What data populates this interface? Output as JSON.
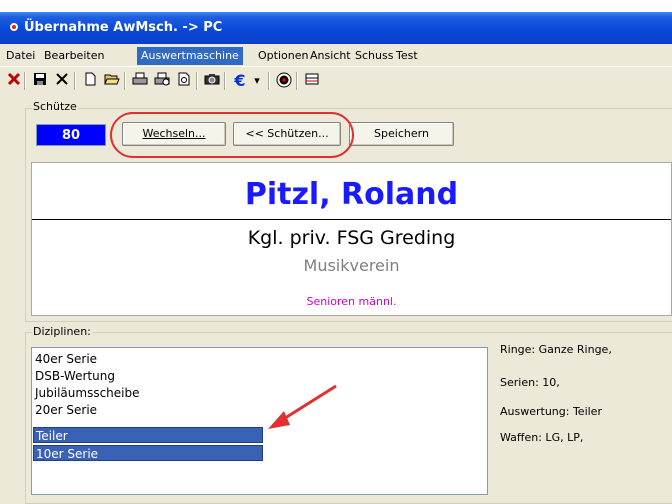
{
  "window": {
    "title": "Übernahme AwMsch. -> PC"
  },
  "menu": [
    "Datei",
    "Bearbeiten",
    "Auswertmaschine",
    "Optionen",
    "Ansicht",
    "Schuss",
    "Test"
  ],
  "toolbar_icons": [
    "close-icon",
    "save-icon",
    "delete-icon",
    "new-document-icon",
    "open-folder-icon",
    "print-icon",
    "print-setup-icon",
    "print-preview-icon",
    "camera-icon",
    "euro-icon",
    "dropdown-arrow-icon",
    "target-icon",
    "layout-icon"
  ],
  "toolbar_glyphs": {
    "euro": "€",
    "dropdown": "▾"
  },
  "schuetze": {
    "group_label": "Schütze",
    "number": "80",
    "wechseln_label": "Wechseln...",
    "schuetzen_label": "<< Schützen...",
    "speichern_label": "Speichern"
  },
  "profile": {
    "name": "Pitzl, Roland",
    "club": "Kgl. priv. FSG Greding",
    "subclub": "Musikverein",
    "category": "Senioren männl."
  },
  "disziplinen": {
    "group_label": "Diziplinen:",
    "items": [
      {
        "label": "40er Serie",
        "selected": false
      },
      {
        "label": "DSB-Wertung",
        "selected": false
      },
      {
        "label": "Jubiläumsscheibe",
        "selected": false
      },
      {
        "label": "20er Serie",
        "selected": false
      },
      {
        "label": "Teiler",
        "selected": true
      },
      {
        "label": "10er Serie",
        "selected": true
      }
    ]
  },
  "details": {
    "ringe": "Ringe: Ganze Ringe,",
    "serien": "Serien: 10,",
    "auswertung": "Auswertung: Teiler",
    "waffen": "Waffen: LG, LP,"
  },
  "colors": {
    "accent": "#0000ff",
    "name": "#1a1aff",
    "category": "#cc00cc",
    "selection": "#3a62b4",
    "annotation": "#e03030"
  }
}
